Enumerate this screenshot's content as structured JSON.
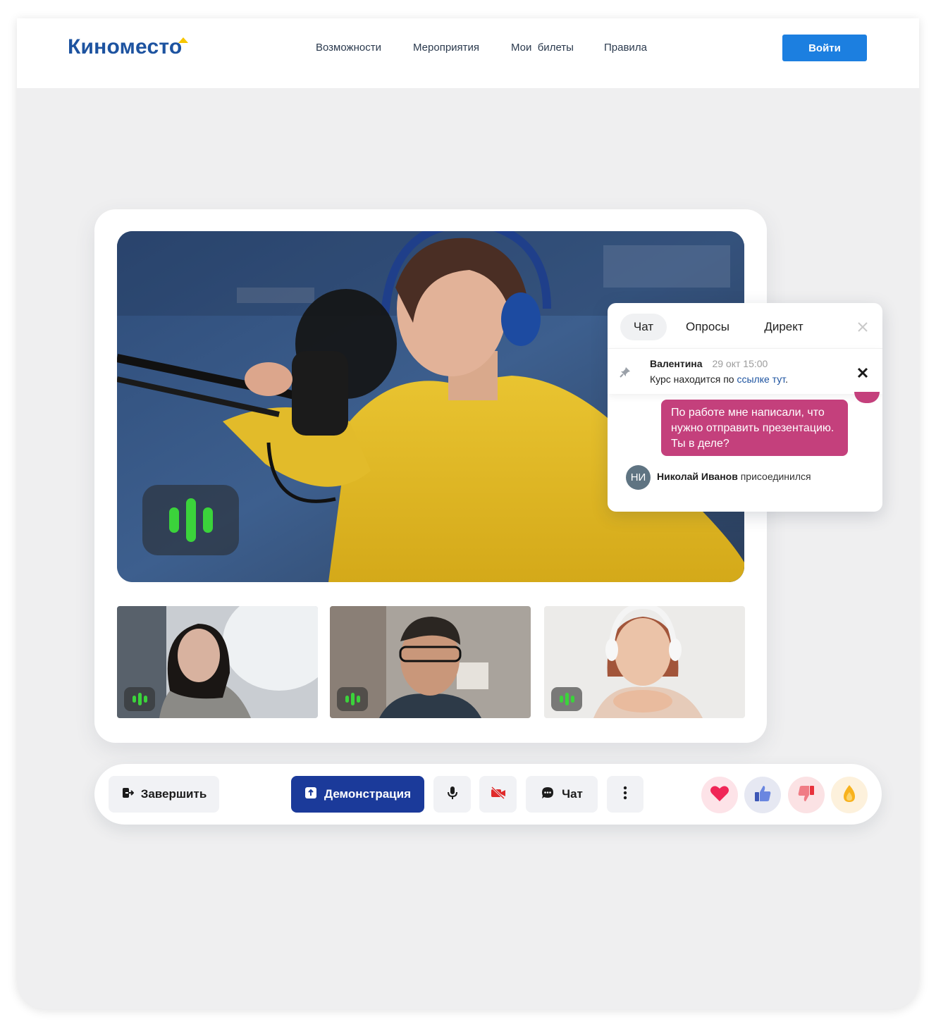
{
  "header": {
    "logo": "Киноместо",
    "nav": [
      "Возможности",
      "Мероприятия",
      "Мои  билеты",
      "Правила"
    ],
    "login_label": "Войти"
  },
  "chat": {
    "tabs": [
      "Чат",
      "Опросы",
      "Директ"
    ],
    "pinned": {
      "author": "Валентина",
      "time": "29 окт 15:00",
      "text_before": "Курс находится по ",
      "link_text": "ссылке тут",
      "text_after": "."
    },
    "message": "По работе мне написали, что нужно отправить презентацию. Ты в деле?",
    "join_event": {
      "initials": "НИ",
      "name": "Николай Иванов",
      "action": "присоединился"
    }
  },
  "controls": {
    "end_label": "Завершить",
    "share_label": "Демонстрация",
    "chat_label": "Чат"
  },
  "colors": {
    "brand": "#1d53a0",
    "primary_button": "#1b3a9a",
    "login_button": "#1c7fe0",
    "message_bubble": "#c4407c",
    "audio_indicator": "#3bd33b"
  },
  "icons": [
    "exit-icon",
    "upload-icon",
    "microphone-icon",
    "camera-off-icon",
    "chat-bubble-icon",
    "more-vertical-icon",
    "heart-icon",
    "thumbs-up-icon",
    "thumbs-down-icon",
    "fire-icon",
    "pin-icon",
    "close-icon"
  ]
}
